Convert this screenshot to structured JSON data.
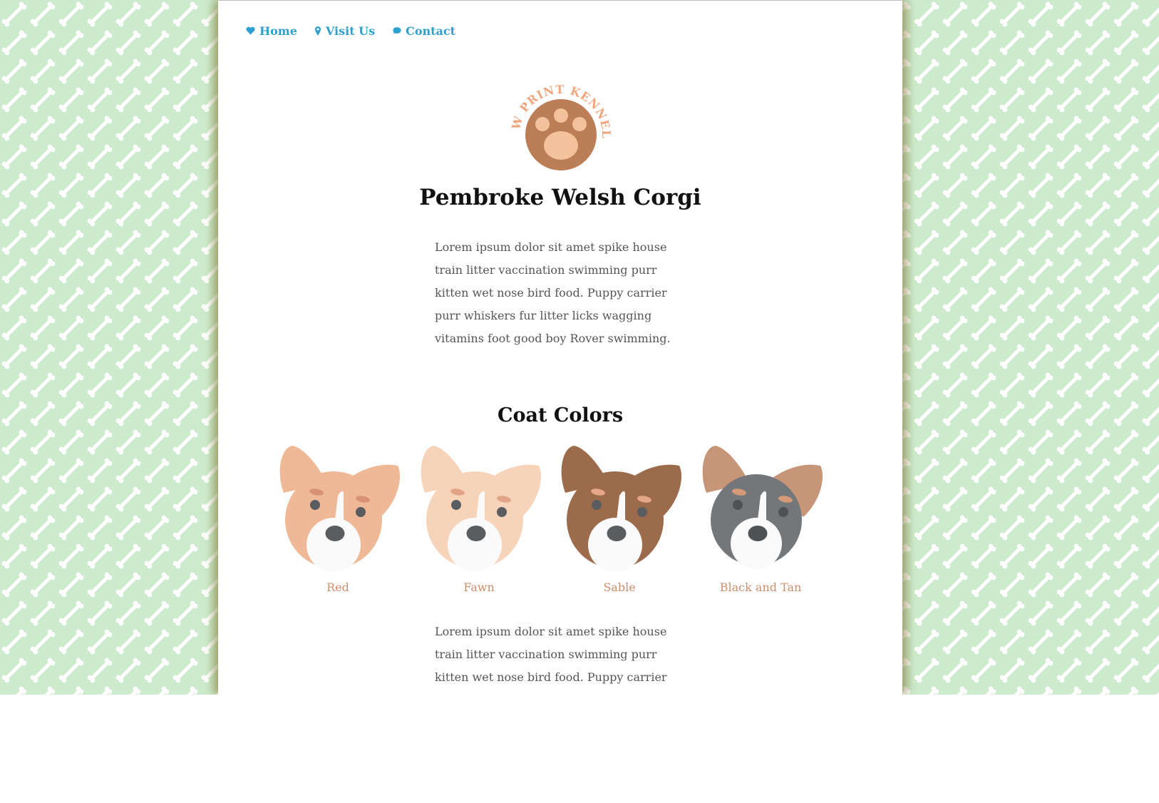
{
  "nav": {
    "items": [
      {
        "label": "Home",
        "icon": "heart-icon"
      },
      {
        "label": "Visit Us",
        "icon": "map-pin-icon"
      },
      {
        "label": "Contact",
        "icon": "chat-bubble-icon"
      }
    ]
  },
  "logo": {
    "text": "PAW PRINT KENNELS"
  },
  "page": {
    "title": "Pembroke Welsh Corgi",
    "intro": "Lorem ipsum dolor sit amet spike house train litter vaccination swimming purr kitten wet nose bird food. Puppy carrier purr whiskers fur litter licks wagging vitamins foot good boy Rover swimming.",
    "coat_heading": "Coat Colors",
    "coats": [
      {
        "label": "Red",
        "ear_color": "#efb896",
        "face_color": "#efb896"
      },
      {
        "label": "Fawn",
        "ear_color": "#f7d3b9",
        "face_color": "#f7d3b9"
      },
      {
        "label": "Sable",
        "ear_color": "#9b6b4b",
        "face_color": "#9b6b4b"
      },
      {
        "label": "Black and Tan",
        "ear_color": "#c79678",
        "face_color": "#74777a"
      }
    ],
    "outro": "Lorem ipsum dolor sit amet spike house train litter vaccination swimming purr kitten wet nose bird food. Puppy carrier purr whiskers fur litter licks wagging vitamins foot good boy Rover swimming."
  },
  "colors": {
    "background": "#cdeccd",
    "bone": "#ffffff",
    "nav_link": "#2e9fcf",
    "logo_text": "#efa57d",
    "logo_circle": "#bb7e57",
    "coat_label": "#cd8e6c"
  }
}
